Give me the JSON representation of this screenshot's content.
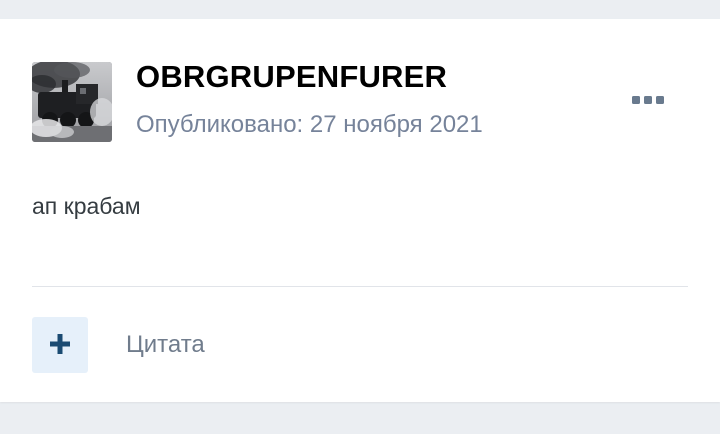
{
  "post": {
    "author": "OBRGRUPENFURER",
    "published": "Опубликовано: 27 ноября 2021",
    "content": "ап крабам"
  },
  "actions": {
    "quote_label": "Цитата"
  },
  "icons": {
    "menu": "ellipsis-icon",
    "quote": "plus-icon",
    "avatar": "steam-locomotive"
  },
  "colors": {
    "page_background": "#ebeef2",
    "card_background": "#ffffff",
    "meta_text": "#76839a",
    "accent": "#1b4b72",
    "quote_button_background": "#e6f0fa"
  }
}
